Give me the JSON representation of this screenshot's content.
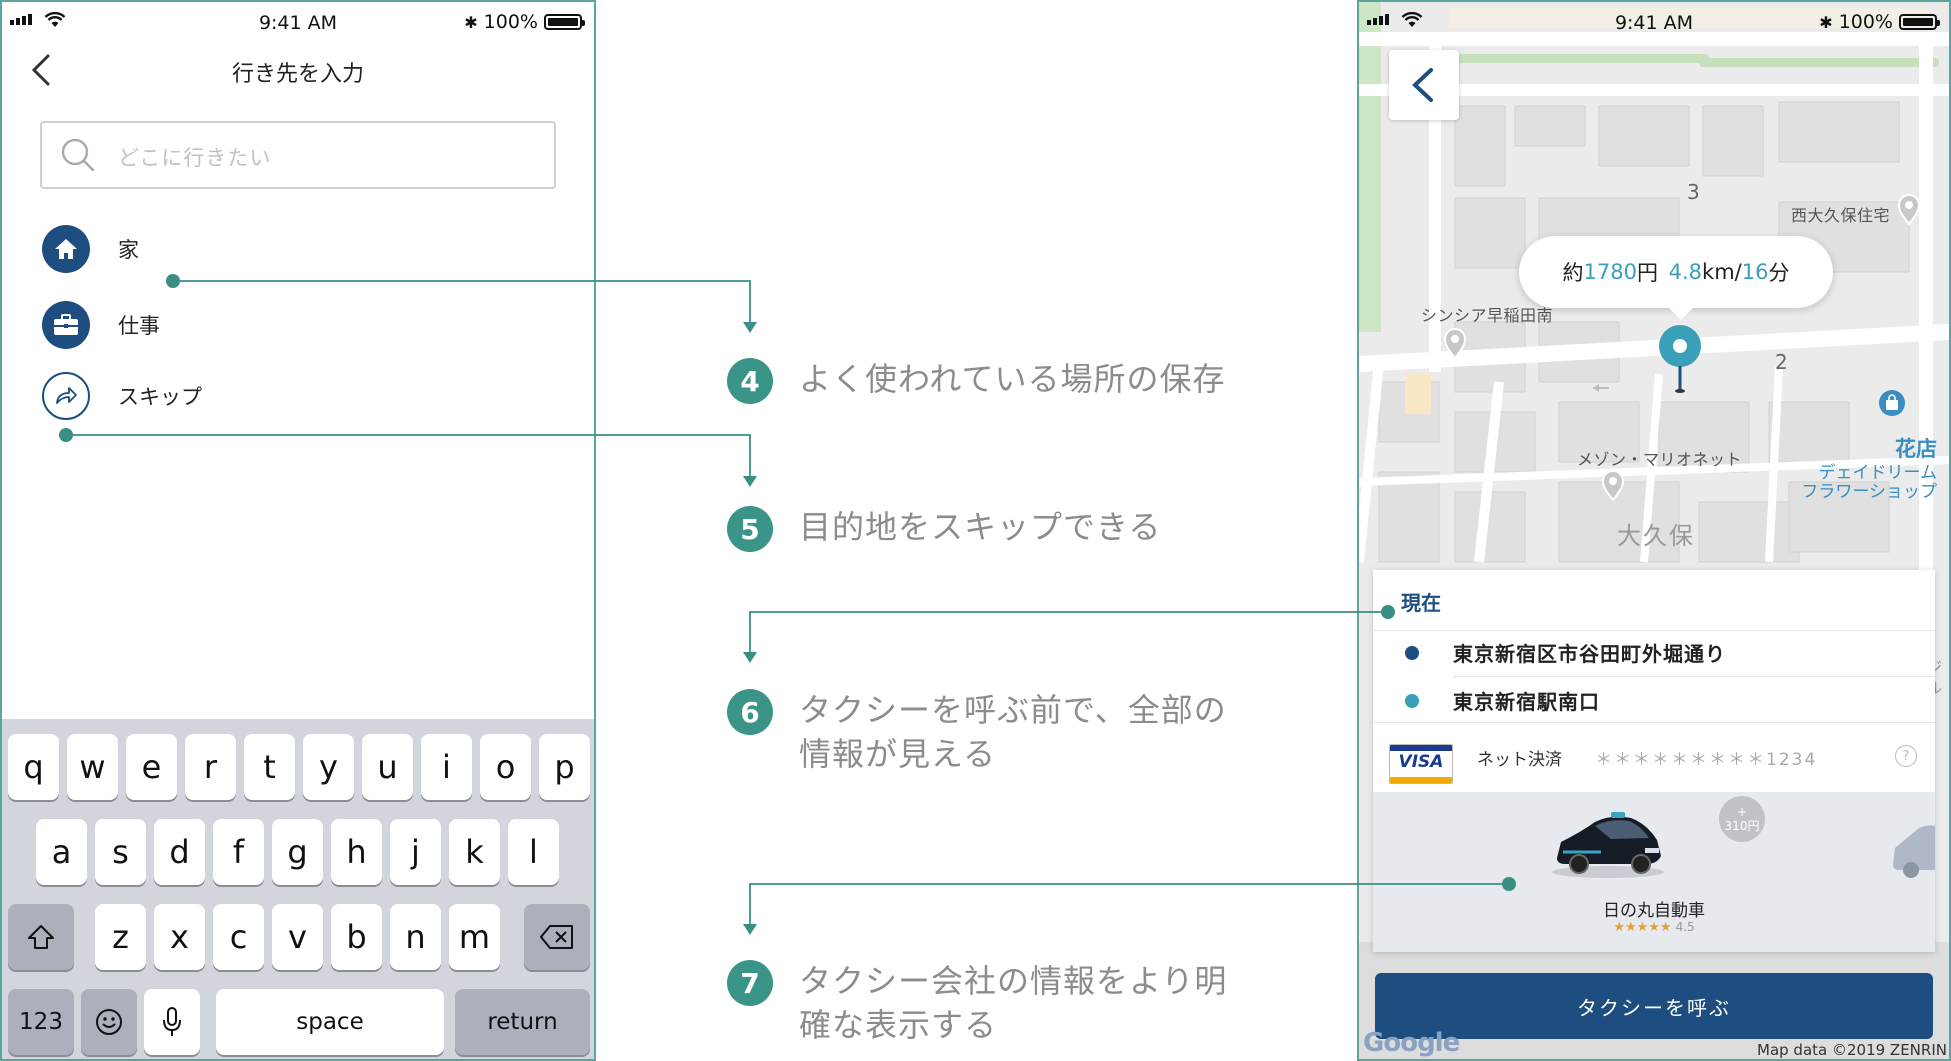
{
  "status": {
    "time": "9:41 AM",
    "battery": "100%"
  },
  "left_phone": {
    "title": "行き先を入力",
    "search_placeholder": "どこに行きたい",
    "places": [
      {
        "label": "家",
        "icon": "home-icon"
      },
      {
        "label": "仕事",
        "icon": "briefcase-icon"
      },
      {
        "label": "スキップ",
        "icon": "skip-arrow-icon"
      }
    ],
    "keyboard": {
      "row1": [
        "q",
        "w",
        "e",
        "r",
        "t",
        "y",
        "u",
        "i",
        "o",
        "p"
      ],
      "row2": [
        "a",
        "s",
        "d",
        "f",
        "g",
        "h",
        "j",
        "k",
        "l"
      ],
      "row3": [
        "z",
        "x",
        "c",
        "v",
        "b",
        "n",
        "m"
      ],
      "numbers": "123",
      "space": "space",
      "return": "return"
    }
  },
  "annotations": [
    {
      "num": "4",
      "text": "よく使われている場所の保存"
    },
    {
      "num": "5",
      "text": "目的地をスキップできる"
    },
    {
      "num": "6",
      "text": "タクシーを呼ぶ前で、全部の\n情報が見える"
    },
    {
      "num": "7",
      "text": "タクシー会社の情報をより明\n確な表示する"
    }
  ],
  "right_phone": {
    "fare": {
      "prefix": "約",
      "price": "1780",
      "yen": "円 ",
      "distance": "4.8",
      "km": "km/",
      "minutes": "16",
      "min": "分"
    },
    "map_labels": {
      "block3": "3",
      "block2": "2",
      "nishiokubo": "西大久保住宅",
      "syncia": "シンシア早稲田南",
      "maison": "メゾン・マリオネット",
      "okubo": "大久保",
      "florist_kind": "花店",
      "florist_name": "デェイドリーム\nフラワーショップ",
      "edge_text": "ジル"
    },
    "card": {
      "now_label": "現在",
      "from": "東京新宿区市谷田町外堀通り",
      "to": "東京新宿駅南口",
      "payment_brand": "VISA",
      "payment_method": "ネット決済",
      "card_number": "＊＊＊＊＊＊＊＊＊1234",
      "help": "?",
      "extra_plus": "+",
      "extra_price": "310円",
      "company": "日の丸自動車",
      "stars": "★★★★★",
      "rating": "4.5"
    },
    "cta": "タクシーを呼ぶ",
    "google": "Google",
    "map_data": "Map data ©2019 ZENRIN"
  },
  "colors": {
    "primary": "#1d4e7f",
    "accent": "#3a9fb8",
    "annotation": "#3a9588",
    "border": "#5aa69b"
  }
}
